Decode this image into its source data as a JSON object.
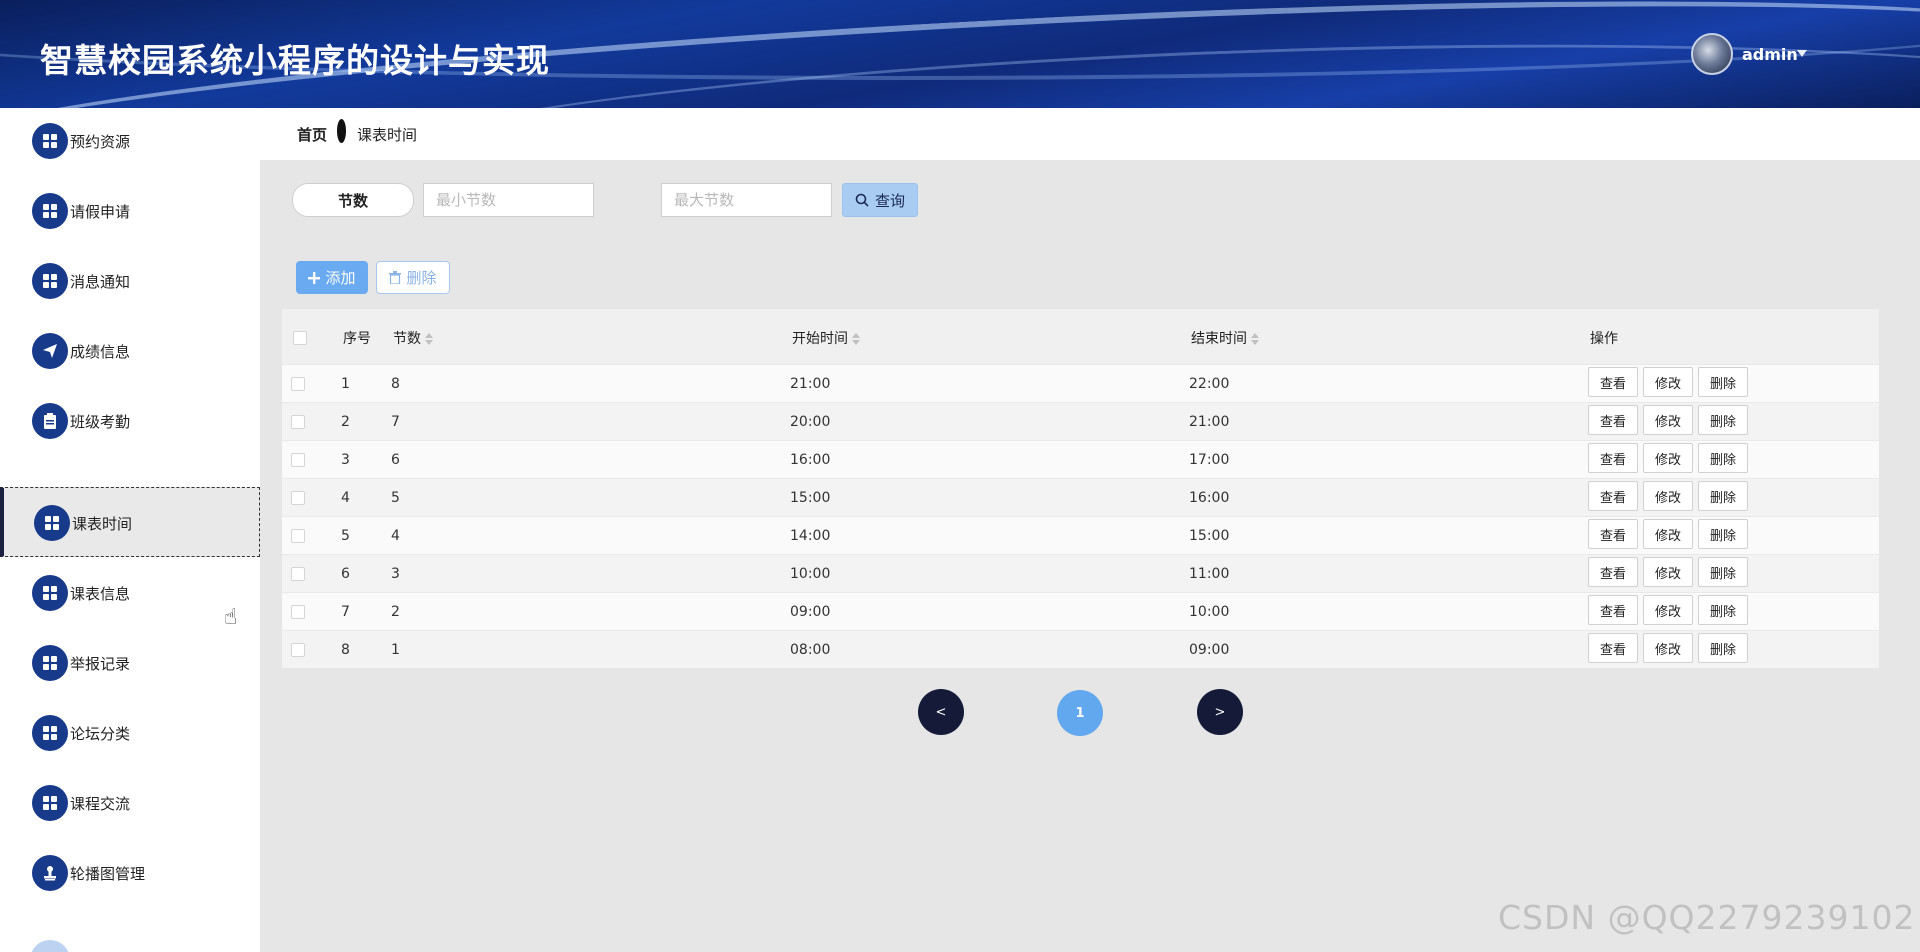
{
  "header": {
    "title": "智慧校园系统小程序的设计与实现",
    "username": "admin"
  },
  "sidebar": {
    "items": [
      {
        "label": "预约资源",
        "icon": "grid-icon"
      },
      {
        "label": "请假申请",
        "icon": "grid-icon"
      },
      {
        "label": "消息通知",
        "icon": "grid-icon"
      },
      {
        "label": "成绩信息",
        "icon": "send-icon"
      },
      {
        "label": "班级考勤",
        "icon": "clipboard-icon"
      },
      {
        "label": "课表时间",
        "icon": "grid-icon",
        "active": true
      },
      {
        "label": "课表信息",
        "icon": "grid-icon"
      },
      {
        "label": "举报记录",
        "icon": "grid-icon"
      },
      {
        "label": "论坛分类",
        "icon": "grid-icon"
      },
      {
        "label": "课程交流",
        "icon": "grid-icon"
      },
      {
        "label": "轮播图管理",
        "icon": "stamp-icon"
      }
    ]
  },
  "breadcrumb": {
    "home": "首页",
    "current": "课表时间"
  },
  "search": {
    "label": "节数",
    "min_placeholder": "最小节数",
    "max_placeholder": "最大节数",
    "query_label": "查询"
  },
  "actions": {
    "add_label": "添加",
    "delete_label": "删除"
  },
  "table": {
    "headers": {
      "index": "序号",
      "section": "节数",
      "start": "开始时间",
      "end": "结束时间",
      "ops": "操作"
    },
    "rows": [
      {
        "index": "1",
        "section": "8",
        "start": "21:00",
        "end": "22:00"
      },
      {
        "index": "2",
        "section": "7",
        "start": "20:00",
        "end": "21:00"
      },
      {
        "index": "3",
        "section": "6",
        "start": "16:00",
        "end": "17:00"
      },
      {
        "index": "4",
        "section": "5",
        "start": "15:00",
        "end": "16:00"
      },
      {
        "index": "5",
        "section": "4",
        "start": "14:00",
        "end": "15:00"
      },
      {
        "index": "6",
        "section": "3",
        "start": "10:00",
        "end": "11:00"
      },
      {
        "index": "7",
        "section": "2",
        "start": "09:00",
        "end": "10:00"
      },
      {
        "index": "8",
        "section": "1",
        "start": "08:00",
        "end": "09:00"
      }
    ],
    "row_actions": {
      "view": "查看",
      "edit": "修改",
      "delete": "删除"
    }
  },
  "pagination": {
    "prev": "<",
    "current": "1",
    "next": ">"
  },
  "watermark": "CSDN @QQ2279239102",
  "colors": {
    "header_bg": "#123a9c",
    "sidebar_icon": "#173a8a",
    "primary": "#6aaaf0",
    "page_current": "#62a8ef",
    "page_nav": "#141a38"
  }
}
